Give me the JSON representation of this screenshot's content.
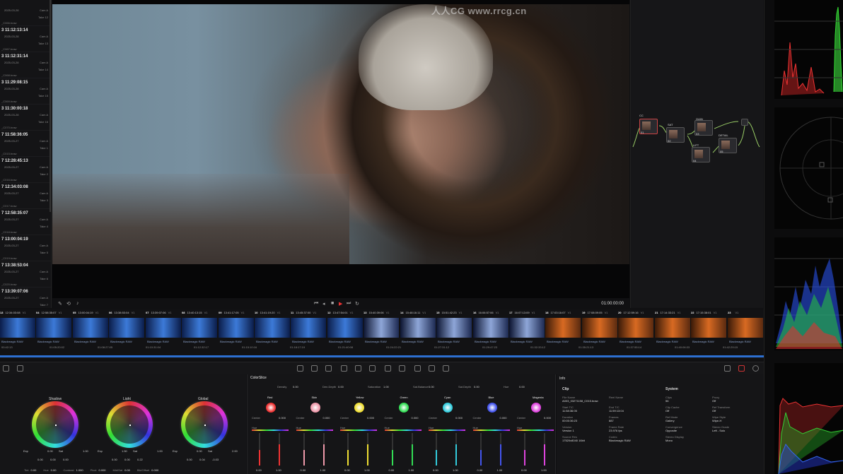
{
  "clips": [
    {
      "tc": "",
      "date": "2025-03-28",
      "cam": "Cam A",
      "take": "Take 12",
      "file": "_C066.braw"
    },
    {
      "tc": "3 11:12:13:14",
      "date": "2025-03-28",
      "cam": "Cam A",
      "take": "Take 13",
      "file": "_C067.braw"
    },
    {
      "tc": "3 11:12:31:14",
      "date": "2025-03-28",
      "cam": "Cam A",
      "take": "Take 14",
      "file": "_C068.braw"
    },
    {
      "tc": "3 11:29:08:15",
      "date": "2025-03-28",
      "cam": "Cam A",
      "take": "Take 15",
      "file": "_C069.braw"
    },
    {
      "tc": "3 11:30:00:18",
      "date": "2025-03-28",
      "cam": "Cam A",
      "take": "Take 16",
      "file": "_C070.braw"
    },
    {
      "tc": "7 11:58:36:05",
      "date": "2025-03-27",
      "cam": "Cam A",
      "take": "Take 1",
      "file": "_C015.braw"
    },
    {
      "tc": "7 12:28:45:13",
      "date": "2025-03-27",
      "cam": "Cam A",
      "take": "Take 2",
      "file": "_C016.braw"
    },
    {
      "tc": "7 12:34:03:08",
      "date": "2025-03-27",
      "cam": "Cam A",
      "take": "Take 3",
      "file": "_C017.braw"
    },
    {
      "tc": "7 12:58:35:07",
      "date": "2025-03-27",
      "cam": "Cam A",
      "take": "Take 4",
      "file": "_C018.braw"
    },
    {
      "tc": "7 13:00:04:19",
      "date": "2025-03-27",
      "cam": "Cam A",
      "take": "Take 5",
      "file": "_C019.braw"
    },
    {
      "tc": "7 13:38:53:04",
      "date": "2025-03-27",
      "cam": "Cam A",
      "take": "Take 6",
      "file": "_C020.braw"
    },
    {
      "tc": "7 13:39:07:06",
      "date": "2025-03-27",
      "cam": "Cam A",
      "take": "Take 7",
      "file": "_C021.braw"
    }
  ],
  "viewer": {
    "watermark": "人人CG www.rrcg.cn",
    "timecode": "01:00:00:00"
  },
  "nodes": {
    "labels": [
      "CC",
      "SAT",
      "GAIN",
      "LIFT",
      "DETAIL"
    ],
    "numbers": [
      "01",
      "02",
      "03",
      "04",
      "05"
    ]
  },
  "timeline": {
    "clips": [
      {
        "num": "13",
        "tc": "12:34:03:08",
        "track": "V1"
      },
      {
        "num": "04",
        "tc": "12:58:35:07",
        "track": "V1"
      },
      {
        "num": "05",
        "tc": "13:00:04:19",
        "track": "V1"
      },
      {
        "num": "06",
        "tc": "13:38:53:04",
        "track": "V1"
      },
      {
        "num": "07",
        "tc": "13:39:07:06",
        "track": "V1"
      },
      {
        "num": "08",
        "tc": "13:40:13:15",
        "track": "V1"
      },
      {
        "num": "09",
        "tc": "13:41:17:05",
        "track": "V1"
      },
      {
        "num": "10",
        "tc": "13:41:19:20",
        "track": "V1"
      },
      {
        "num": "11",
        "tc": "13:45:37:00",
        "track": "V1"
      },
      {
        "num": "12",
        "tc": "13:47:54:01",
        "track": "V1"
      },
      {
        "num": "13",
        "tc": "15:40:39:06",
        "track": "V1"
      },
      {
        "num": "14",
        "tc": "15:48:16:11",
        "track": "V1"
      },
      {
        "num": "15",
        "tc": "15:51:42:23",
        "track": "V1"
      },
      {
        "num": "16",
        "tc": "16:06:57:06",
        "track": "V1"
      },
      {
        "num": "17",
        "tc": "16:07:13:09",
        "track": "V1"
      },
      {
        "num": "18",
        "tc": "17:03:16:07",
        "track": "V1"
      },
      {
        "num": "19",
        "tc": "17:08:09:05",
        "track": "V1"
      },
      {
        "num": "20",
        "tc": "17:12:59:16",
        "track": "V1"
      },
      {
        "num": "21",
        "tc": "17:14:33:21",
        "track": "V1"
      },
      {
        "num": "22",
        "tc": "17:15:38:01",
        "track": "V1"
      },
      {
        "num": "23",
        "tc": "",
        "track": "V1"
      }
    ],
    "thumb_label": "Blackmagic RAW",
    "ruler": [
      "00:42:13",
      "01:05:20:02",
      "01:08:27:05",
      "01:10:31:04",
      "01:12:32:17",
      "01:15:10:16",
      "01:18:17:19",
      "01:21:40:08",
      "01:24:22:21",
      "01:27:31:12",
      "01:29:47:23",
      "01:32:33:12",
      "01:35:21:13",
      "01:37:55:14",
      "01:40:06:33",
      "01:42:29:15"
    ]
  },
  "wheels": {
    "items": [
      {
        "name": "Shadow",
        "vals": [
          "0.00",
          "0.00",
          "0.00"
        ],
        "left": "1.00",
        "right": "1.00",
        "exp_label": "Exp",
        "exp": "0.00",
        "sat_label": "Sat",
        "sat": "1.00"
      },
      {
        "name": "Light",
        "vals": [
          "0.00",
          "0.00",
          "0.22"
        ],
        "left": "1.50",
        "right": "1.00",
        "exp_label": "Exp",
        "exp": "1.50",
        "sat_label": "Sat",
        "sat": "1.00"
      },
      {
        "name": "Global",
        "vals": [
          "0.00",
          "0.04",
          "-0.03"
        ],
        "left": "0.00",
        "right": "2.00",
        "exp_label": "Exp",
        "exp": "0.00",
        "sat_label": "Sat",
        "sat": "2.00"
      }
    ],
    "bottom": [
      "Tint",
      "0.00",
      "Hue",
      "0.00",
      "Contrast",
      "1.000",
      "Pivot",
      "0.000",
      "Mid/Sat",
      "0.00",
      "Blk/Offset",
      "0.000"
    ]
  },
  "slice": {
    "title": "ColorSlice",
    "top": [
      {
        "k": "Density",
        "v": "0.00"
      },
      {
        "k": "Den.Depth",
        "v": "0.00"
      },
      {
        "k": "Saturation",
        "v": "1.00"
      },
      {
        "k": "Sat.Balance",
        "v": "0.00"
      },
      {
        "k": "Sat.Depth",
        "v": "0.00"
      },
      {
        "k": "Hue",
        "v": "0.00"
      }
    ],
    "vectors": [
      {
        "name": "Red",
        "center": "0.000",
        "color": "#e33"
      },
      {
        "name": "Skin",
        "center": "0.000",
        "color": "#e9a"
      },
      {
        "name": "Yellow",
        "center": "0.000",
        "color": "#ed3"
      },
      {
        "name": "Green",
        "center": "0.000",
        "color": "#3d5"
      },
      {
        "name": "Cyan",
        "center": "0.000",
        "color": "#3cd"
      },
      {
        "name": "Blue",
        "center": "0.000",
        "color": "#45e"
      },
      {
        "name": "Magenta",
        "center": "0.000",
        "color": "#d4d"
      }
    ],
    "center_label": "Center",
    "hue_label": "Hue",
    "bar_vals": [
      "0.00",
      "1.00"
    ]
  },
  "info": {
    "title": "Info",
    "clip_title": "Clip",
    "system_title": "System",
    "left": [
      {
        "k": "File Name",
        "v": "A003_03271158_C015.braw"
      },
      {
        "k": "Start T/C",
        "v": "11:58:36:05"
      },
      {
        "k": "Duration",
        "v": "00:00:36:23"
      },
      {
        "k": "Version",
        "v": "Version 1"
      },
      {
        "k": "Source Res",
        "v": "17520x8040 16bit"
      }
    ],
    "right": [
      {
        "k": "Reel Name",
        "v": ""
      },
      {
        "k": "End T/C",
        "v": "11:59:13:04"
      },
      {
        "k": "Frames",
        "v": "887"
      },
      {
        "k": "Frame Rate",
        "v": "23.976 fps"
      },
      {
        "k": "Codec",
        "v": "Blackmagic RAW"
      }
    ],
    "system_left": [
      {
        "k": "Clips",
        "v": "56"
      },
      {
        "k": "Clip Cache",
        "v": "Off"
      },
      {
        "k": "Ref Mode",
        "v": "Gallery"
      },
      {
        "k": "Convergence",
        "v": "Opposite"
      },
      {
        "k": "Stereo Display",
        "v": "Mono"
      }
    ],
    "system_right": [
      {
        "k": "Proxy",
        "v": "Off"
      },
      {
        "k": "Ref Transform",
        "v": "Off"
      },
      {
        "k": "Wipe Style",
        "v": "Wipe-H"
      },
      {
        "k": "Stereo Grade",
        "v": "Left - Solo"
      }
    ]
  }
}
